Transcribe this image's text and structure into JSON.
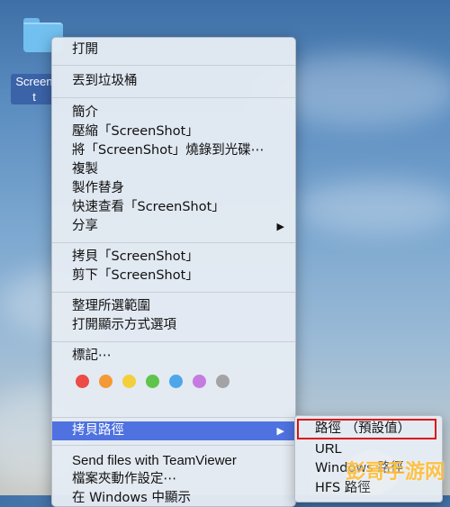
{
  "desktop": {
    "folder_label": "ScreenShot",
    "folder_label_line1": "Screen",
    "folder_label_line2": "t"
  },
  "menu": {
    "open": "打開",
    "trash": "丟到垃圾桶",
    "info": "簡介",
    "compress": "壓縮「ScreenShot」",
    "burn": "將「ScreenShot」燒錄到光碟⋯",
    "duplicate": "複製",
    "alias": "製作替身",
    "quicklook": "快速查看「ScreenShot」",
    "share": "分享",
    "copy": "拷貝「ScreenShot」",
    "cut": "剪下「ScreenShot」",
    "cleanup": "整理所選範圍",
    "view_options": "打開顯示方式選項",
    "tags": "標記⋯",
    "copy_path": "拷貝路徑",
    "teamviewer": "Send files with TeamViewer",
    "folder_actions": "檔案夾動作設定⋯",
    "windows_show": "在 Windows 中顯示"
  },
  "tag_colors": [
    "#ec4b47",
    "#f39a37",
    "#f4cf3c",
    "#5fc44a",
    "#4ea6ea",
    "#c57be0",
    "#a3a3a5"
  ],
  "tag_color_names": [
    "red",
    "orange",
    "yellow",
    "green",
    "blue",
    "purple",
    "gray"
  ],
  "submenu": {
    "path_default": "路徑 （預設值）",
    "url": "URL",
    "windows_path": "Windows 路徑",
    "hfs_path": "HFS 路徑"
  },
  "watermark": "彭哥手游网",
  "icons": {
    "submenu_arrow": "▶"
  },
  "colors": {
    "highlight": "#4f72e0",
    "callout": "#dd1111"
  }
}
